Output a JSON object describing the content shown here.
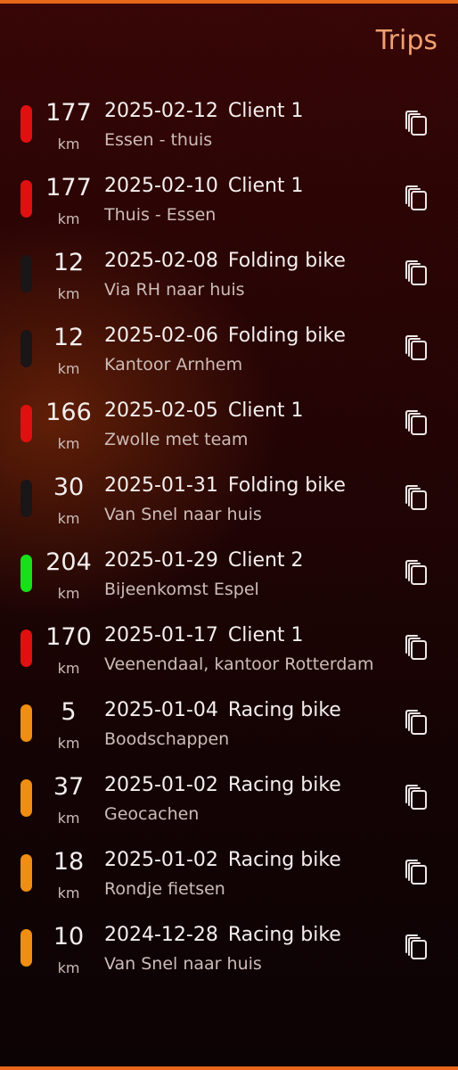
{
  "header": {
    "title": "Trips"
  },
  "colors": {
    "accent": "#e8681a",
    "title": "#f0a070",
    "client1": "#e01010",
    "client2": "#18e018",
    "folding_bike": "#1a1516",
    "racing_bike": "#ef8e12"
  },
  "trips": [
    {
      "distance": "177",
      "unit": "km",
      "date": "2025-02-12",
      "vehicle": "Client 1",
      "description": "Essen - thuis",
      "color": "#e01010",
      "icon": "copy-icon"
    },
    {
      "distance": "177",
      "unit": "km",
      "date": "2025-02-10",
      "vehicle": "Client 1",
      "description": "Thuis - Essen",
      "color": "#e01010",
      "icon": "copy-icon"
    },
    {
      "distance": "12",
      "unit": "km",
      "date": "2025-02-08",
      "vehicle": "Folding bike",
      "description": "Via RH naar huis",
      "color": "#1a1516",
      "icon": "copy-icon"
    },
    {
      "distance": "12",
      "unit": "km",
      "date": "2025-02-06",
      "vehicle": "Folding bike",
      "description": "Kantoor Arnhem",
      "color": "#1a1516",
      "icon": "copy-icon"
    },
    {
      "distance": "166",
      "unit": "km",
      "date": "2025-02-05",
      "vehicle": "Client 1",
      "description": "Zwolle met team",
      "color": "#e01010",
      "icon": "copy-icon"
    },
    {
      "distance": "30",
      "unit": "km",
      "date": "2025-01-31",
      "vehicle": "Folding bike",
      "description": "Van Snel naar huis",
      "color": "#1a1516",
      "icon": "copy-icon"
    },
    {
      "distance": "204",
      "unit": "km",
      "date": "2025-01-29",
      "vehicle": "Client 2",
      "description": "Bijeenkomst Espel",
      "color": "#18e018",
      "icon": "copy-icon"
    },
    {
      "distance": "170",
      "unit": "km",
      "date": "2025-01-17",
      "vehicle": "Client 1",
      "description": "Veenendaal, kantoor Rotterdam",
      "color": "#e01010",
      "icon": "copy-icon"
    },
    {
      "distance": "5",
      "unit": "km",
      "date": "2025-01-04",
      "vehicle": "Racing bike",
      "description": "Boodschappen",
      "color": "#ef8e12",
      "icon": "copy-icon"
    },
    {
      "distance": "37",
      "unit": "km",
      "date": "2025-01-02",
      "vehicle": "Racing bike",
      "description": "Geocachen",
      "color": "#ef8e12",
      "icon": "copy-icon"
    },
    {
      "distance": "18",
      "unit": "km",
      "date": "2025-01-02",
      "vehicle": "Racing bike",
      "description": "Rondje fietsen",
      "color": "#ef8e12",
      "icon": "copy-icon"
    },
    {
      "distance": "10",
      "unit": "km",
      "date": "2024-12-28",
      "vehicle": "Racing bike",
      "description": "Van Snel naar huis",
      "color": "#ef8e12",
      "icon": "copy-icon"
    }
  ]
}
